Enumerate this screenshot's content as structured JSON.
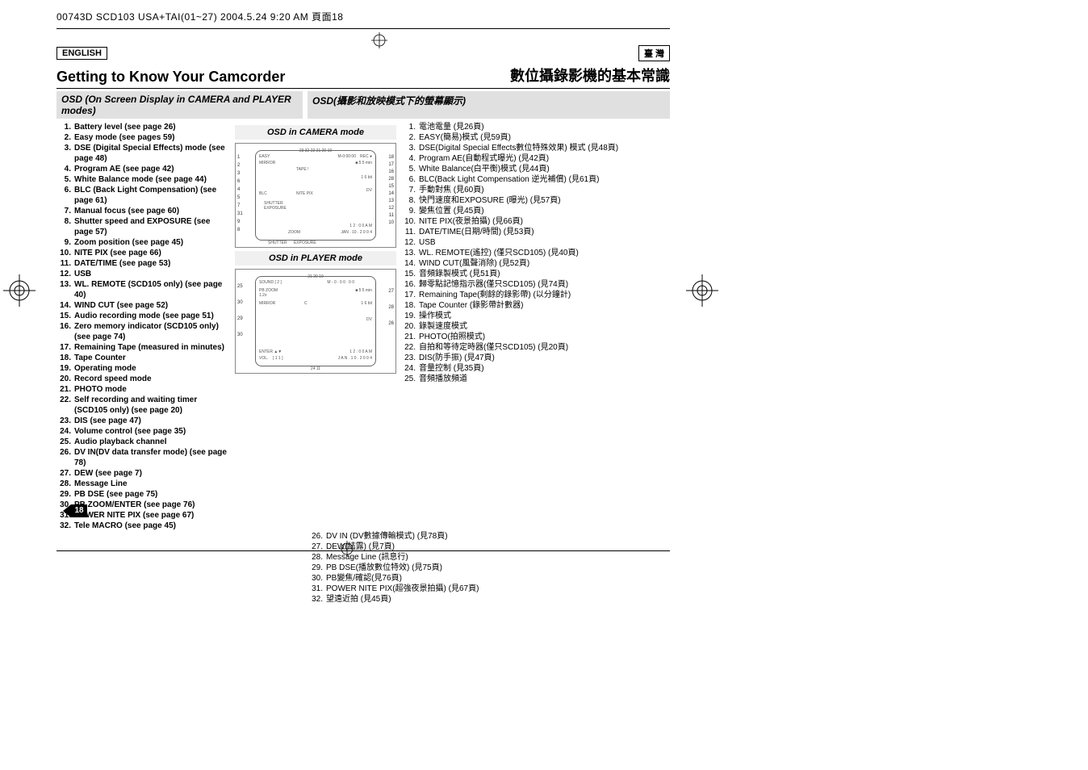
{
  "header_line": "00743D SCD103 USA+TAI(01~27)  2004.5.24  9:20 AM  頁面18",
  "lang_en": "ENGLISH",
  "lang_zh": "臺 灣",
  "title_en": "Getting to Know Your Camcorder",
  "title_zh": "數位攝錄影機的基本常識",
  "subhead_en": "OSD (On Screen Display in CAMERA and PLAYER modes)",
  "subhead_zh": "OSD(攝影和放映模式下的螢幕顯示)",
  "osd_camera_title": "OSD in CAMERA mode",
  "osd_player_title": "OSD in PLAYER mode",
  "page_number": "18",
  "list_en": [
    "Battery level (see page 26)",
    "Easy mode (see pages 59)",
    "DSE (Digital Special Effects) mode (see page 48)",
    "Program AE (see page 42)",
    "White Balance mode (see page 44)",
    "BLC (Back Light Compensation) (see page 61)",
    "Manual focus (see page 60)",
    "Shutter speed and EXPOSURE (see page 57)",
    "Zoom position (see page 45)",
    "NITE PIX (see page 66)",
    "DATE/TIME (see page 53)",
    "USB",
    "WL. REMOTE (SCD105 only) (see page 40)",
    "WIND CUT (see page 52)",
    "Audio recording mode (see page 51)",
    "Zero memory indicator (SCD105 only) (see page 74)",
    "Remaining Tape (measured in minutes)",
    "Tape Counter",
    "Operating mode",
    "Record speed mode",
    "PHOTO mode",
    "Self recording and waiting timer (SCD105 only) (see page 20)",
    "DIS (see page 47)",
    "Volume control (see page 35)",
    "Audio playback channel",
    "DV IN(DV data transfer mode) (see page 78)",
    "DEW (see page 7)",
    "Message Line",
    "PB DSE (see page 75)",
    "PB ZOOM/ENTER (see page 76)",
    "POWER NITE PIX (see page 67)",
    "Tele MACRO (see page 45)"
  ],
  "list_zh_top": [
    "電池電量 (見26頁)",
    "EASY(簡易)模式 (見59頁)",
    "DSE(Digital Special Effects數位特殊效果) 模式 (見48頁)",
    "Program AE(自動程式曝光) (見42頁)",
    "White Balance(白平衡)模式 (見44頁)",
    "BLC(Back Light Compensation 逆光補償) (見61頁)",
    "手動對焦 (見60頁)",
    "快門速度和EXPOSURE (曝光) (見57頁)",
    "變焦位置 (見45頁)",
    "NITE PIX(夜景拍攝) (見66頁)",
    "DATE/TIME(日期/時間) (見53頁)",
    "USB",
    "WL. REMOTE(遙控) (僅只SCD105) (見40頁)",
    "WIND CUT(風聲消除) (見52頁)",
    "音頻錄製模式 (見51頁)",
    "歸零點記憶指示器(僅只SCD105) (見74頁)",
    "Remaining Tape(剩餘的錄影帶) (以分鐘計)",
    "Tape Counter (錄影帶計數器)",
    "操作模式",
    "錄製速度模式",
    "PHOTO(拍照模式)",
    "自拍和等待定時器(僅只SCD105) (見20頁)",
    "DIS(防手振) (見47頁)",
    "音量控制 (見35頁)",
    "音頻播放頻道"
  ],
  "list_zh_bottom": [
    "DV IN (DV數據傳輸模式) (見78頁)",
    "DEW(結露) (見7頁)",
    "Message Line (訊息行)",
    "PB DSE(播放數位特效) (見75頁)",
    "PB變焦/確認(見76頁)",
    "POWER NITE PIX(超強夜景拍攝) (見67頁)",
    "望遠近拍 (見45頁)"
  ],
  "osd_camera_labels": {
    "top_numbers": "23 32 22 21     20     19",
    "left_numbers": [
      "1",
      "2",
      "3",
      "6",
      "4",
      "5",
      "7",
      "31",
      "9",
      "8"
    ],
    "right_numbers": [
      "18",
      "17",
      "16",
      "28",
      "15",
      "14",
      "13",
      "12",
      "11",
      "10"
    ],
    "inner": [
      "EASY",
      "MIRROR",
      "M-0:00:00",
      "REC",
      "5 5 min",
      "BLC",
      "TAPE !",
      "1 6 bit",
      "NITE PIX",
      "DV",
      "SHUTTER",
      "EXPOSURE",
      "1 2 : 0 0 A M",
      "JAN . 10 . 2 0 0 4",
      "ZOOM",
      "SHUTTER",
      "EXPOSURE"
    ]
  },
  "osd_player_labels": {
    "top_numbers": "21     20     19",
    "left_numbers": [
      "25",
      "30",
      "29",
      "30"
    ],
    "right_numbers": [
      "27",
      "28",
      "26"
    ],
    "bottom_numbers": "24        11",
    "inner": [
      "SOUND [ 2 ]",
      "PB ZOOM",
      "1.2x",
      "MIRROR",
      "M - 0 : 0 0 : 0 0",
      "5 5 min",
      "1 6 bit",
      "C",
      "DV",
      "1 2 : 0 0 A M",
      "J A N . 1 0 . 2 0 0 4",
      "ENTER",
      "VOL.",
      "[ 1 1 ]"
    ]
  }
}
